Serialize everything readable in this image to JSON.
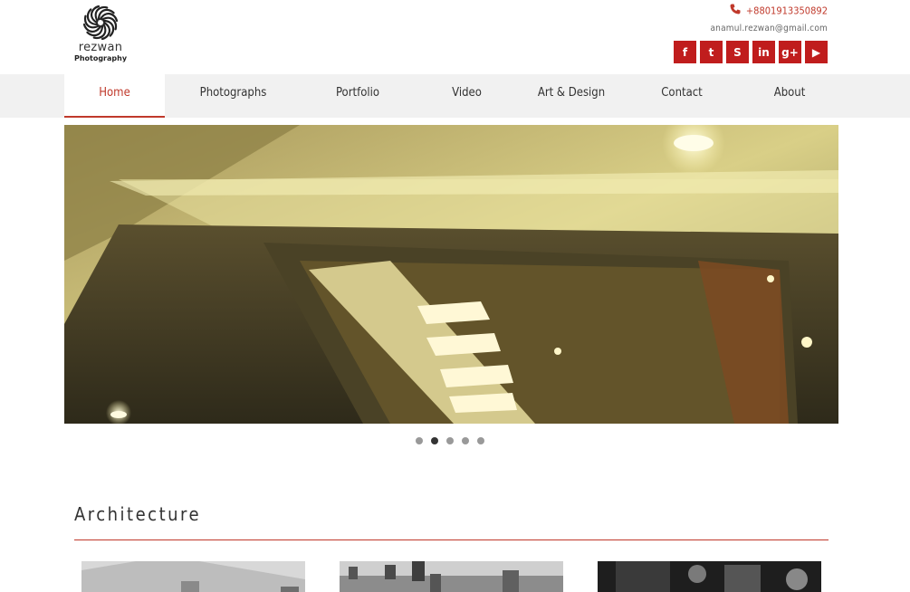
{
  "brand": {
    "logo_text": "rezwan",
    "logo_sub": "Photography"
  },
  "contact": {
    "phone": "+8801913350892",
    "email": "anamul.rezwan@gmail.com"
  },
  "social": [
    {
      "icon": "facebook-icon",
      "glyph": "f"
    },
    {
      "icon": "twitter-icon",
      "glyph": "t"
    },
    {
      "icon": "skype-icon",
      "glyph": "S"
    },
    {
      "icon": "linkedin-icon",
      "glyph": "in"
    },
    {
      "icon": "googleplus-icon",
      "glyph": "g+"
    },
    {
      "icon": "youtube-icon",
      "glyph": "▶"
    }
  ],
  "nav": {
    "home": "Home",
    "photographs": "Photographs",
    "portfolio": "Portfolio",
    "video": "Video",
    "art_design": "Art & Design",
    "contact": "Contact",
    "about": "About"
  },
  "slider": {
    "slide_count": 5,
    "active_slide": 2
  },
  "section": {
    "title": "Architecture"
  },
  "colors": {
    "accent": "#c0392b",
    "social_bg": "#c01d1d",
    "nav_bg": "#f1f1f1",
    "text": "#333333"
  }
}
